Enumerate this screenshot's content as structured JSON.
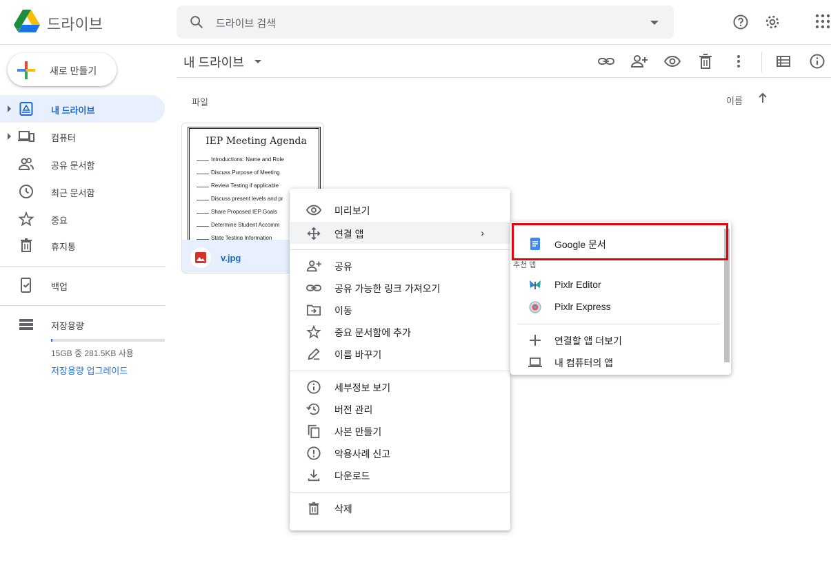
{
  "app": {
    "title": "드라이브"
  },
  "search": {
    "placeholder": "드라이브 검색"
  },
  "new_button": {
    "label": "새로 만들기"
  },
  "sidebar": {
    "items": [
      {
        "label": "내 드라이브",
        "icon": "my-drive-icon",
        "active": true
      },
      {
        "label": "컴퓨터",
        "icon": "computer-icon"
      },
      {
        "label": "공유 문서함",
        "icon": "shared-people-icon"
      },
      {
        "label": "최근 문서함",
        "icon": "clock-icon"
      },
      {
        "label": "중요",
        "icon": "star-icon"
      },
      {
        "label": "휴지통",
        "icon": "trash-icon"
      },
      {
        "label": "백업",
        "icon": "backup-icon"
      },
      {
        "label": "저장용량",
        "icon": "storage-icon"
      }
    ],
    "storage": {
      "text": "15GB 중 281.5KB 사용",
      "upgrade": "저장용량 업그레이드",
      "used_fraction": 0.01
    }
  },
  "content": {
    "breadcrumb": "내 드라이브",
    "section_label": "파일",
    "sort_label": "이름"
  },
  "file": {
    "name": "v.jpg",
    "thumbnail": {
      "title": "IEP Meeting Agenda",
      "lines": [
        "Introductions: Name and Role",
        "Discuss Purpose of Meeting",
        "Review Testing if applicable",
        "Discuss present levels and pr",
        "Share Proposed IEP Goals",
        "Determine Student Accomm",
        "State Testing Information"
      ]
    }
  },
  "context_menu": {
    "items": [
      {
        "label": "미리보기",
        "icon": "eye-icon"
      },
      {
        "label": "연결 앱",
        "icon": "move-arrows-icon",
        "has_submenu": true
      },
      {
        "label": "공유",
        "icon": "person-add-icon"
      },
      {
        "label": "공유 가능한 링크 가져오기",
        "icon": "link-icon"
      },
      {
        "label": "이동",
        "icon": "folder-move-icon"
      },
      {
        "label": "중요 문서함에 추가",
        "icon": "star-outline-icon"
      },
      {
        "label": "이름 바꾸기",
        "icon": "pencil-icon"
      },
      {
        "label": "세부정보 보기",
        "icon": "info-icon"
      },
      {
        "label": "버전 관리",
        "icon": "history-icon"
      },
      {
        "label": "사본 만들기",
        "icon": "copy-icon"
      },
      {
        "label": "악용사례 신고",
        "icon": "report-icon"
      },
      {
        "label": "다운로드",
        "icon": "download-icon"
      },
      {
        "label": "삭제",
        "icon": "trash-icon"
      }
    ],
    "submenu_chevron": "›"
  },
  "submenu": {
    "items": [
      {
        "label": "Google 문서",
        "icon": "google-docs-icon"
      },
      {
        "label": "Pixlr Editor",
        "icon": "pixlr-editor-icon"
      },
      {
        "label": "Pixlr Express",
        "icon": "pixlr-express-icon"
      },
      {
        "label": "연결할 앱 더보기",
        "icon": "plus-icon"
      },
      {
        "label": "내 컴퓨터의 앱",
        "icon": "laptop-icon"
      }
    ],
    "section_label": "추천 앱"
  },
  "colors": {
    "accent": "#1a73e8",
    "active_bg": "#e8f0fe",
    "highlight_box": "#e8000b"
  }
}
